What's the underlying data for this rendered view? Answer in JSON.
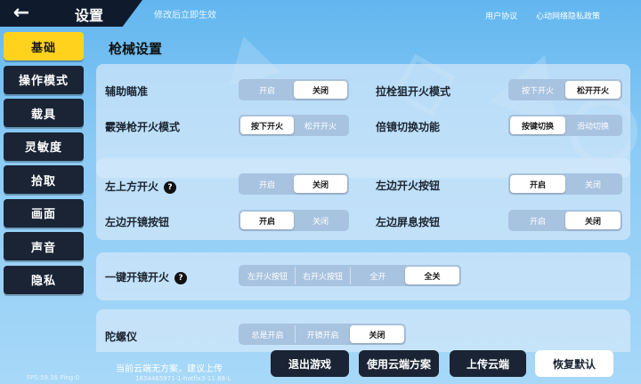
{
  "header": {
    "title": "设置",
    "hint": "修改后立即生效",
    "links": [
      "用户协议",
      "心动网络隐私政策"
    ]
  },
  "sidebar": {
    "items": [
      {
        "label": "基础",
        "active": true
      },
      {
        "label": "操作模式",
        "active": false
      },
      {
        "label": "载具",
        "active": false
      },
      {
        "label": "灵敏度",
        "active": false
      },
      {
        "label": "拾取",
        "active": false
      },
      {
        "label": "画面",
        "active": false
      },
      {
        "label": "声音",
        "active": false
      },
      {
        "label": "隐私",
        "active": false
      }
    ]
  },
  "section": {
    "title": "枪械设置"
  },
  "settings": {
    "aim_assist": {
      "label": "辅助瞄准",
      "options": [
        "开启",
        "关闭"
      ],
      "selected": "关闭"
    },
    "bolt_sniper_fire": {
      "label": "拉栓狙开火模式",
      "options": [
        "按下开火",
        "松开开火"
      ],
      "selected": "松开开火"
    },
    "shotgun_fire": {
      "label": "霰弹枪开火模式",
      "options": [
        "按下开火",
        "松开开火"
      ],
      "selected": "按下开火"
    },
    "scope_switch": {
      "label": "倍镜切换功能",
      "options": [
        "按键切换",
        "滑动切换"
      ],
      "selected": "按键切换"
    },
    "left_top_fire": {
      "label": "左上方开火",
      "options": [
        "开启",
        "关闭"
      ],
      "selected": "关闭"
    },
    "left_fire_button": {
      "label": "左边开火按钮",
      "options": [
        "开启",
        "关闭"
      ],
      "selected": "开启"
    },
    "left_scope_button": {
      "label": "左边开镜按钮",
      "options": [
        "开启",
        "关闭"
      ],
      "selected": "开启"
    },
    "left_breath_button": {
      "label": "左边屏息按钮",
      "options": [
        "开启",
        "关闭"
      ],
      "selected": "关闭"
    },
    "one_key_scope_fire": {
      "label": "一键开镜开火",
      "options": [
        "左开火按钮",
        "右开火按钮",
        "全开",
        "全关"
      ],
      "selected": "全关"
    },
    "gyroscope": {
      "label": "陀螺仪",
      "options": [
        "总是开启",
        "开镜开启",
        "关闭"
      ],
      "selected": "关闭"
    }
  },
  "footer": {
    "cloud_note": "当前云端无方案，建议上传",
    "fps": "FPS:59.36 Ping:0",
    "build": "1634465971-1-hotfix3-11.68-L",
    "buttons": {
      "exit": "退出游戏",
      "use_cloud": "使用云端方案",
      "upload_cloud": "上传云端",
      "restore": "恢复默认"
    }
  }
}
